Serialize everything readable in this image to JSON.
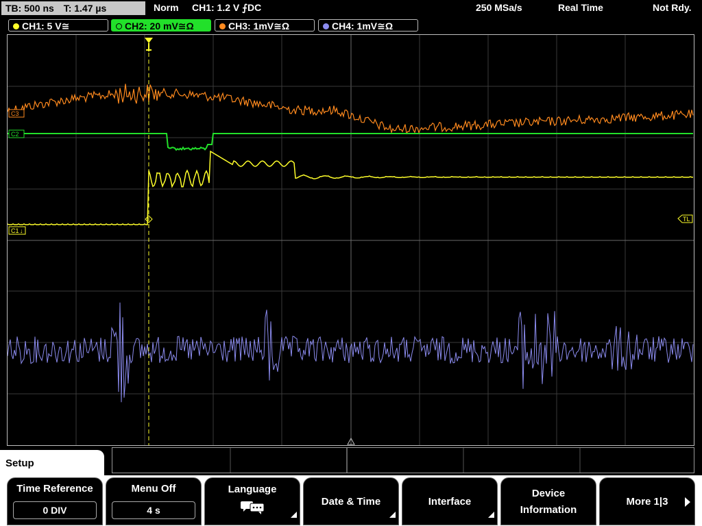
{
  "top": {
    "timebase": "TB: 500 ns",
    "trigger_time": "T: 1.47 µs",
    "mode": "Norm",
    "trigger": "CH1: 1.2 V ⨍DC",
    "sample_rate": "250 MSa/s",
    "acq_mode": "Real Time",
    "status": "Not Rdy."
  },
  "channels": [
    {
      "label": "CH1: 5 V≅",
      "color": "#ffff2a"
    },
    {
      "label": "CH2: 20 mV≅Ω",
      "color": "#22e02a"
    },
    {
      "label": "CH3: 1mV≅Ω",
      "color": "#ff8a1e"
    },
    {
      "label": "CH4: 1mV≅Ω",
      "color": "#8c8cf0"
    }
  ],
  "markers": {
    "ch1": "C1",
    "ch2": "C2",
    "ch3": "C3",
    "trigger_level": "TL",
    "trigger_pos": "T"
  },
  "menu": {
    "title": "Setup",
    "time_reference": {
      "label": "Time Reference",
      "value": "0 DIV"
    },
    "menu_off": {
      "label": "Menu Off",
      "value": "4 s"
    },
    "language": {
      "label": "Language"
    },
    "date_time": {
      "label": "Date & Time"
    },
    "interface": {
      "label": "Interface"
    },
    "device_information": {
      "label1": "Device",
      "label2": "Information"
    },
    "more": {
      "label": "More 1|3"
    }
  }
}
